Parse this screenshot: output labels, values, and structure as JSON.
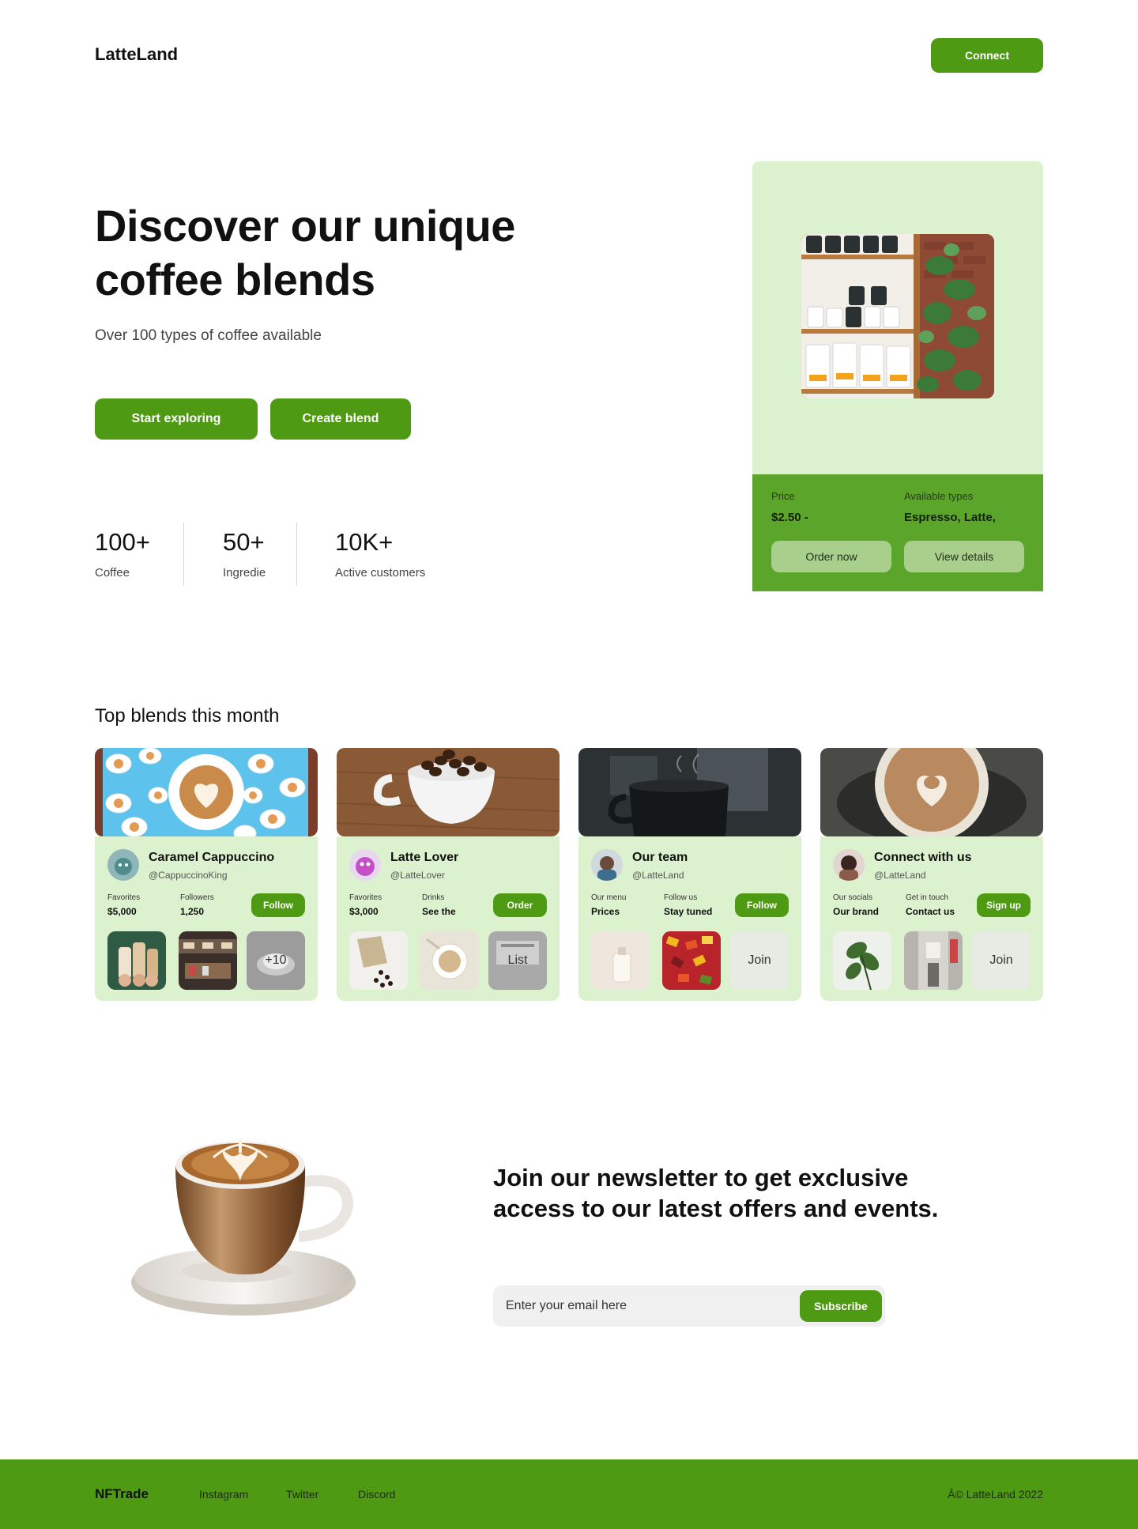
{
  "header": {
    "brand": "LatteLand",
    "connect_label": "Connect"
  },
  "hero": {
    "title": "Discover our unique coffee blends",
    "subtitle": "Over 100 types of coffee available",
    "explore_label": "Start exploring",
    "create_label": "Create blend",
    "stats": [
      {
        "value": "100+",
        "label": "Coffee"
      },
      {
        "value": "50+",
        "label": "Ingredie"
      },
      {
        "value": "10K+",
        "label": "Active customers"
      }
    ],
    "card": {
      "price_label": "Price",
      "price_value": "$2.50 -",
      "types_label": "Available types",
      "types_value": "Espresso, Latte,",
      "order_label": "Order now",
      "details_label": "View details"
    }
  },
  "blends": {
    "title": "Top blends this month",
    "cards": [
      {
        "name": "Caramel Cappuccino",
        "handle": "@CappuccinoKing",
        "stat1_label": "Favorites",
        "stat1_value": "$5,000",
        "stat2_label": "Followers",
        "stat2_value": "1,250",
        "button": "Follow",
        "thumb3_text": "+10"
      },
      {
        "name": "Latte Lover",
        "handle": "@LatteLover",
        "stat1_label": "Favorites",
        "stat1_value": "$3,000",
        "stat2_label": "Drinks",
        "stat2_value": "See the",
        "button": "Order",
        "thumb3_text": "List"
      },
      {
        "name": "Our team",
        "handle": "@LatteLand",
        "stat1_label": "Our menu",
        "stat1_value": "Prices",
        "stat2_label": "Follow us",
        "stat2_value": "Stay tuned",
        "button": "Follow",
        "thumb3_text": "Join"
      },
      {
        "name": "Connect with us",
        "handle": "@LatteLand",
        "stat1_label": "Our socials",
        "stat1_value": "Our brand",
        "stat2_label": "Get in touch",
        "stat2_value": "Contact us",
        "button": "Sign up",
        "thumb3_text": "Join"
      }
    ]
  },
  "newsletter": {
    "title": "Join our newsletter to get exclusive access to our latest offers and events.",
    "placeholder": "Enter your email here",
    "subscribe_label": "Subscribe"
  },
  "footer": {
    "brand": "NFTrade",
    "links": [
      "Instagram",
      "Twitter",
      "Discord"
    ],
    "copyright": "Â© LatteLand 2022"
  },
  "colors": {
    "accent": "#4f9a13",
    "card_bg": "#dcf1ce",
    "card_strip": "#5aa52a"
  }
}
